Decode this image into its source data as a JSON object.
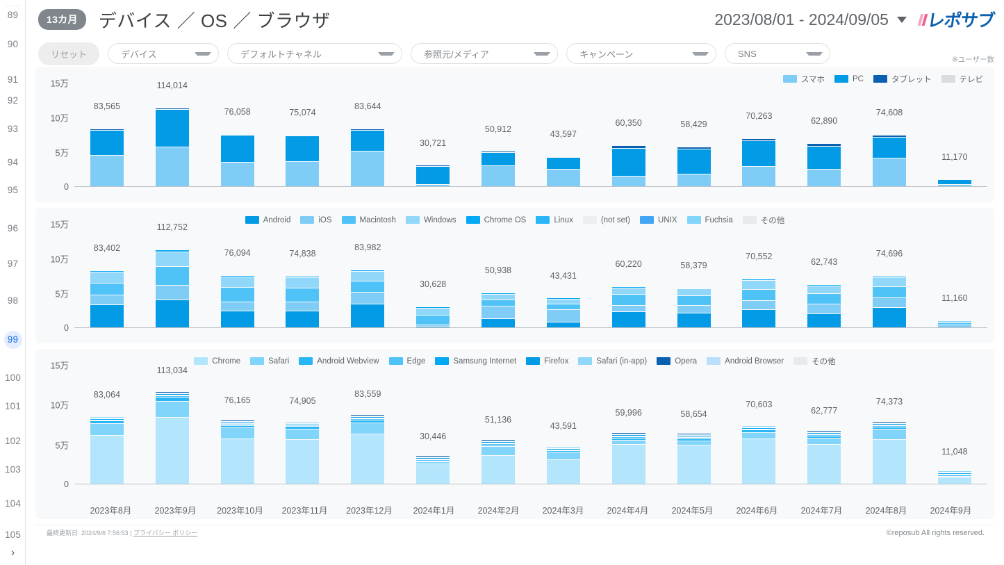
{
  "rail": {
    "pages": [
      "89",
      "90",
      "91",
      "92",
      "93",
      "94",
      "95",
      "96",
      "97",
      "98",
      "99",
      "100",
      "101",
      "102",
      "103",
      "104",
      "105"
    ],
    "active": "99",
    "next_icon": "›"
  },
  "header": {
    "badge": "13カ月",
    "title": "デバイス ／ OS ／ ブラウザ",
    "date_range": "2023/08/01 - 2024/09/05",
    "logo_text": "レポサブ",
    "logo_color": "#0b5fb0"
  },
  "filters": {
    "reset": "リセット",
    "items": [
      {
        "label": "デバイス",
        "width_class": "w-device"
      },
      {
        "label": "デフォルトチャネル",
        "width_class": "w-channel"
      },
      {
        "label": "参照元/メディア",
        "width_class": "w-source"
      },
      {
        "label": "キャンペーン",
        "width_class": "w-camp"
      },
      {
        "label": "SNS",
        "width_class": "w-sns"
      }
    ],
    "note": "※ユーザー数"
  },
  "footer": {
    "updated": "最終更新日: 2024/9/6 7:56:53",
    "separator": "|",
    "privacy": "プライバシー ポリシー",
    "copyright": "©reposub All rights reserved."
  },
  "chart_data": [
    {
      "type": "bar",
      "stacked": true,
      "title": "デバイス",
      "xlabel": "",
      "ylabel": "",
      "ylim": [
        0,
        150000
      ],
      "yticks": [
        0,
        50000,
        100000,
        150000
      ],
      "ytick_labels": [
        "0",
        "5万",
        "10万",
        "15万"
      ],
      "grid": false,
      "legend_position": "top-right",
      "categories": [
        "2023年8月",
        "2023年9月",
        "2023年10月",
        "2023年11月",
        "2023年12月",
        "2024年1月",
        "2024年2月",
        "2024年3月",
        "2024年4月",
        "2024年5月",
        "2024年6月",
        "2024年7月",
        "2024年8月",
        "2024年9月"
      ],
      "totals": [
        83565,
        114014,
        76058,
        75074,
        83644,
        30721,
        50912,
        43597,
        60350,
        58429,
        70263,
        62890,
        74608,
        11170
      ],
      "total_labels": [
        "83,565",
        "114,014",
        "76,058",
        "75,074",
        "83,644",
        "30,721",
        "50,912",
        "43,597",
        "60,350",
        "58,429",
        "70,263",
        "62,890",
        "74,608",
        "11,170"
      ],
      "series": [
        {
          "name": "スマホ",
          "color": "#7fcdf7",
          "values": [
            46000,
            58500,
            36500,
            37500,
            52000,
            4300,
            31500,
            26500,
            16500,
            19500,
            30500,
            26500,
            42000,
            4300
          ]
        },
        {
          "name": "PC",
          "color": "#039be5",
          "values": [
            36000,
            54000,
            38500,
            36500,
            30500,
            26000,
            18800,
            16500,
            39500,
            35500,
            36500,
            33000,
            30500,
            6700
          ]
        },
        {
          "name": "タブレット",
          "color": "#0b5fb0",
          "values": [
            1565,
            1514,
            1058,
            1074,
            1144,
            421,
            612,
            597,
            4350,
            3429,
            3263,
            3390,
            2108,
            170
          ]
        },
        {
          "name": "テレビ",
          "color": "#d9dde0",
          "values": [
            0,
            0,
            0,
            0,
            0,
            0,
            0,
            0,
            0,
            0,
            0,
            0,
            0,
            0
          ]
        }
      ]
    },
    {
      "type": "bar",
      "stacked": true,
      "title": "OS",
      "xlabel": "",
      "ylabel": "",
      "ylim": [
        0,
        150000
      ],
      "yticks": [
        0,
        50000,
        100000,
        150000
      ],
      "ytick_labels": [
        "0",
        "5万",
        "10万",
        "15万"
      ],
      "grid": false,
      "legend_position": "top-center",
      "categories": [
        "2023年8月",
        "2023年9月",
        "2023年10月",
        "2023年11月",
        "2023年12月",
        "2024年1月",
        "2024年2月",
        "2024年3月",
        "2024年4月",
        "2024年5月",
        "2024年6月",
        "2024年7月",
        "2024年8月",
        "2024年9月"
      ],
      "totals": [
        83402,
        112752,
        76094,
        74838,
        83982,
        30628,
        50938,
        43431,
        60220,
        58379,
        70552,
        62743,
        74696,
        11160
      ],
      "total_labels": [
        "83,402",
        "112,752",
        "76,094",
        "74,838",
        "83,982",
        "30,628",
        "50,938",
        "43,431",
        "60,220",
        "58,379",
        "70,552",
        "62,743",
        "74,696",
        "11,160"
      ],
      "series": [
        {
          "name": "Android",
          "color": "#039be5",
          "values": [
            34500,
            41500,
            25000,
            25500,
            35000,
            3000,
            14500,
            9500,
            24000,
            22000,
            27000,
            21500,
            30000,
            1400
          ]
        },
        {
          "name": "iOS",
          "color": "#7fcdf7",
          "values": [
            13500,
            20500,
            13000,
            12500,
            17500,
            2500,
            17500,
            17500,
            9000,
            11000,
            13500,
            13500,
            14000,
            3400
          ]
        },
        {
          "name": "Macintosh",
          "color": "#4fc3f7",
          "values": [
            17000,
            27000,
            21000,
            20000,
            16000,
            13500,
            9500,
            8500,
            16000,
            14000,
            16000,
            15000,
            16500,
            3000
          ]
        },
        {
          "name": "Windows",
          "color": "#90d7f9",
          "values": [
            16500,
            21500,
            15500,
            15000,
            14000,
            10500,
            8000,
            7000,
            9500,
            10000,
            12500,
            11500,
            12500,
            3000
          ]
        },
        {
          "name": "Chrome OS",
          "color": "#03a9f4",
          "values": [
            1902,
            2252,
            1594,
            1838,
            1482,
            1128,
            1438,
            931,
            1720,
            1379,
            1552,
            1243,
            1696,
            360
          ]
        },
        {
          "name": "Linux",
          "color": "#29b6f6",
          "values": [
            0,
            0,
            0,
            0,
            0,
            0,
            0,
            0,
            0,
            0,
            0,
            0,
            0,
            0
          ]
        },
        {
          "name": "(not set)",
          "color": "#eceff1",
          "values": [
            0,
            0,
            0,
            0,
            0,
            0,
            0,
            0,
            0,
            0,
            0,
            0,
            0,
            0
          ]
        },
        {
          "name": "UNIX",
          "color": "#42a5f5",
          "values": [
            0,
            0,
            0,
            0,
            0,
            0,
            0,
            0,
            0,
            0,
            0,
            0,
            0,
            0
          ]
        },
        {
          "name": "Fuchsia",
          "color": "#81d4fa",
          "values": [
            0,
            0,
            0,
            0,
            0,
            0,
            0,
            0,
            0,
            0,
            0,
            0,
            0,
            0
          ]
        },
        {
          "name": "その他",
          "color": "#e8eaed",
          "values": [
            0,
            0,
            0,
            0,
            0,
            0,
            0,
            0,
            0,
            0,
            0,
            0,
            0,
            0
          ]
        }
      ]
    },
    {
      "type": "bar",
      "stacked": true,
      "title": "ブラウザ",
      "xlabel": "",
      "ylabel": "",
      "ylim": [
        0,
        150000
      ],
      "yticks": [
        0,
        50000,
        100000,
        150000
      ],
      "ytick_labels": [
        "0",
        "5万",
        "10万",
        "15万"
      ],
      "grid": false,
      "legend_position": "top-center",
      "categories": [
        "2023年8月",
        "2023年9月",
        "2023年10月",
        "2023年11月",
        "2023年12月",
        "2024年1月",
        "2024年2月",
        "2024年3月",
        "2024年4月",
        "2024年5月",
        "2024年6月",
        "2024年7月",
        "2024年8月",
        "2024年9月"
      ],
      "totals": [
        83064,
        113034,
        76165,
        74905,
        83559,
        30446,
        51136,
        43591,
        59996,
        58654,
        70603,
        62777,
        74373,
        11048
      ],
      "total_labels": [
        "83,064",
        "113,034",
        "76,165",
        "74,905",
        "83,559",
        "30,446",
        "51,136",
        "43,591",
        "59,996",
        "58,654",
        "70,603",
        "62,777",
        "74,373",
        "11,048"
      ],
      "series": [
        {
          "name": "Chrome",
          "color": "#b3e5fc",
          "values": [
            62000,
            84500,
            58000,
            57000,
            63500,
            26000,
            36500,
            31500,
            50500,
            49500,
            57500,
            51000,
            56500,
            9600
          ]
        },
        {
          "name": "Safari",
          "color": "#81d4fa",
          "values": [
            14500,
            20000,
            13500,
            13000,
            14500,
            2500,
            11500,
            9500,
            5500,
            5500,
            8000,
            7500,
            13000,
            900
          ]
        },
        {
          "name": "Android Webview",
          "color": "#29b6f6",
          "values": [
            3500,
            5000,
            2800,
            3000,
            3500,
            1100,
            2000,
            1700,
            2800,
            2700,
            3200,
            2900,
            3100,
            350
          ]
        },
        {
          "name": "Edge",
          "color": "#4fc3f7",
          "values": [
            1500,
            1800,
            1100,
            1100,
            1200,
            500,
            700,
            600,
            700,
            600,
            1200,
            900,
            1100,
            130
          ]
        },
        {
          "name": "Samsung Internet",
          "color": "#03a9f4",
          "values": [
            800,
            900,
            400,
            500,
            500,
            200,
            250,
            150,
            300,
            200,
            500,
            300,
            450,
            40
          ]
        },
        {
          "name": "Firefox",
          "color": "#039be5",
          "values": [
            500,
            500,
            250,
            200,
            250,
            100,
            130,
            100,
            150,
            100,
            150,
            130,
            180,
            20
          ]
        },
        {
          "name": "Safari (in-app)",
          "color": "#90d7f9",
          "values": [
            200,
            250,
            90,
            80,
            80,
            40,
            50,
            35,
            40,
            50,
            45,
            40,
            40,
            8
          ]
        },
        {
          "name": "Opera",
          "color": "#0b5fb0",
          "values": [
            64,
            84,
            25,
            25,
            29,
            6,
            6,
            6,
            6,
            4,
            8,
            7,
            3,
            0
          ]
        },
        {
          "name": "Android Browser",
          "color": "#bbdefb",
          "values": [
            0,
            0,
            0,
            0,
            0,
            0,
            0,
            0,
            0,
            0,
            0,
            0,
            0,
            0
          ]
        },
        {
          "name": "その他",
          "color": "#e8eaed",
          "values": [
            0,
            0,
            0,
            0,
            0,
            0,
            0,
            0,
            0,
            0,
            0,
            0,
            0,
            0
          ]
        }
      ]
    }
  ]
}
